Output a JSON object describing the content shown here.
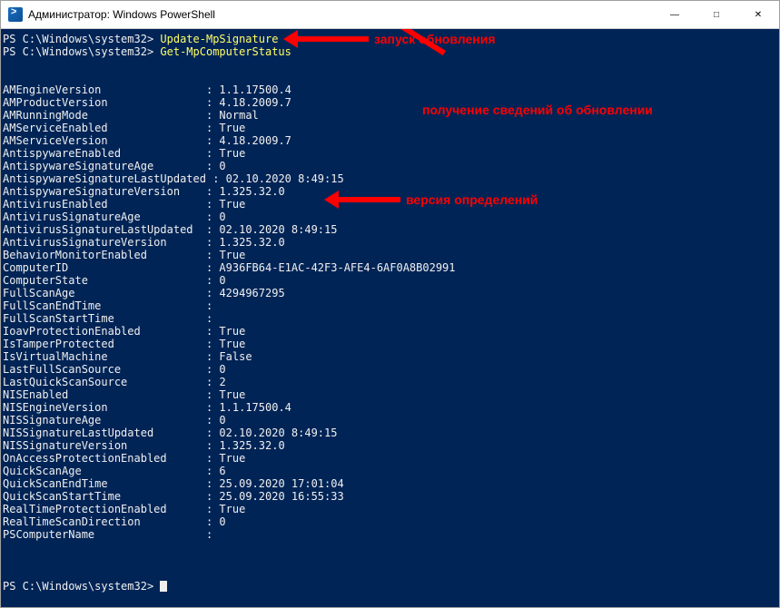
{
  "window": {
    "title": "Администратор: Windows PowerShell"
  },
  "prompt": "PS C:\\Windows\\system32>",
  "commands": {
    "cmd1": "Update-MpSignature",
    "cmd2": "Get-MpComputerStatus"
  },
  "annotations": {
    "a1": "запуск обновления",
    "a2": "получение сведений об обновлении",
    "a3": "версия определений"
  },
  "kv": [
    {
      "k": "AMEngineVersion",
      "v": "1.1.17500.4"
    },
    {
      "k": "AMProductVersion",
      "v": "4.18.2009.7"
    },
    {
      "k": "AMRunningMode",
      "v": "Normal"
    },
    {
      "k": "AMServiceEnabled",
      "v": "True"
    },
    {
      "k": "AMServiceVersion",
      "v": "4.18.2009.7"
    },
    {
      "k": "AntispywareEnabled",
      "v": "True"
    },
    {
      "k": "AntispywareSignatureAge",
      "v": "0"
    },
    {
      "k": "AntispywareSignatureLastUpdated",
      "v": "02.10.2020 8:49:15"
    },
    {
      "k": "AntispywareSignatureVersion",
      "v": "1.325.32.0"
    },
    {
      "k": "AntivirusEnabled",
      "v": "True"
    },
    {
      "k": "AntivirusSignatureAge",
      "v": "0"
    },
    {
      "k": "AntivirusSignatureLastUpdated",
      "v": "02.10.2020 8:49:15"
    },
    {
      "k": "AntivirusSignatureVersion",
      "v": "1.325.32.0"
    },
    {
      "k": "BehaviorMonitorEnabled",
      "v": "True"
    },
    {
      "k": "ComputerID",
      "v": "A936FB64-E1AC-42F3-AFE4-6AF0A8B02991"
    },
    {
      "k": "ComputerState",
      "v": "0"
    },
    {
      "k": "FullScanAge",
      "v": "4294967295"
    },
    {
      "k": "FullScanEndTime",
      "v": ""
    },
    {
      "k": "FullScanStartTime",
      "v": ""
    },
    {
      "k": "IoavProtectionEnabled",
      "v": "True"
    },
    {
      "k": "IsTamperProtected",
      "v": "True"
    },
    {
      "k": "IsVirtualMachine",
      "v": "False"
    },
    {
      "k": "LastFullScanSource",
      "v": "0"
    },
    {
      "k": "LastQuickScanSource",
      "v": "2"
    },
    {
      "k": "NISEnabled",
      "v": "True"
    },
    {
      "k": "NISEngineVersion",
      "v": "1.1.17500.4"
    },
    {
      "k": "NISSignatureAge",
      "v": "0"
    },
    {
      "k": "NISSignatureLastUpdated",
      "v": "02.10.2020 8:49:15"
    },
    {
      "k": "NISSignatureVersion",
      "v": "1.325.32.0"
    },
    {
      "k": "OnAccessProtectionEnabled",
      "v": "True"
    },
    {
      "k": "QuickScanAge",
      "v": "6"
    },
    {
      "k": "QuickScanEndTime",
      "v": "25.09.2020 17:01:04"
    },
    {
      "k": "QuickScanStartTime",
      "v": "25.09.2020 16:55:33"
    },
    {
      "k": "RealTimeProtectionEnabled",
      "v": "True"
    },
    {
      "k": "RealTimeScanDirection",
      "v": "0"
    },
    {
      "k": "PSComputerName",
      "v": ""
    }
  ],
  "key_width": 31
}
